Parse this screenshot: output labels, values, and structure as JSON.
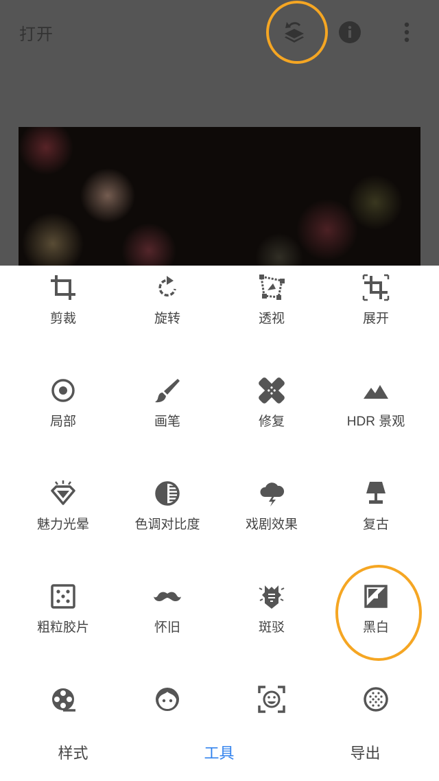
{
  "topbar": {
    "open_label": "打开"
  },
  "icons": {
    "stack": "layers-undo-icon",
    "info": "info-icon",
    "more": "more-vertical-icon"
  },
  "highlight_color": "#F5A623",
  "accent_color": "#2F80ED",
  "tools": [
    {
      "label": "剪裁",
      "icon": "crop-icon"
    },
    {
      "label": "旋转",
      "icon": "rotate-icon"
    },
    {
      "label": "透视",
      "icon": "perspective-icon"
    },
    {
      "label": "展开",
      "icon": "expand-icon"
    },
    {
      "label": "局部",
      "icon": "selective-icon"
    },
    {
      "label": "画笔",
      "icon": "brush-icon"
    },
    {
      "label": "修复",
      "icon": "healing-icon"
    },
    {
      "label": "HDR 景观",
      "icon": "hdr-mountain-icon"
    },
    {
      "label": "魅力光晕",
      "icon": "glamour-glow-icon"
    },
    {
      "label": "色调对比度",
      "icon": "tonal-contrast-icon"
    },
    {
      "label": "戏剧效果",
      "icon": "drama-icon"
    },
    {
      "label": "复古",
      "icon": "vintage-lamp-icon"
    },
    {
      "label": "粗粒胶片",
      "icon": "grainy-film-icon"
    },
    {
      "label": "怀旧",
      "icon": "retrolux-mustache-icon"
    },
    {
      "label": "斑驳",
      "icon": "grunge-icon"
    },
    {
      "label": "黑白",
      "icon": "black-white-icon"
    },
    {
      "label": "",
      "icon": "film-reel-icon"
    },
    {
      "label": "",
      "icon": "face-icon"
    },
    {
      "label": "",
      "icon": "face-frame-icon"
    },
    {
      "label": "",
      "icon": "double-exposure-icon"
    }
  ],
  "bottom_tabs": [
    {
      "label": "样式",
      "active": false
    },
    {
      "label": "工具",
      "active": true
    },
    {
      "label": "导出",
      "active": false
    }
  ]
}
